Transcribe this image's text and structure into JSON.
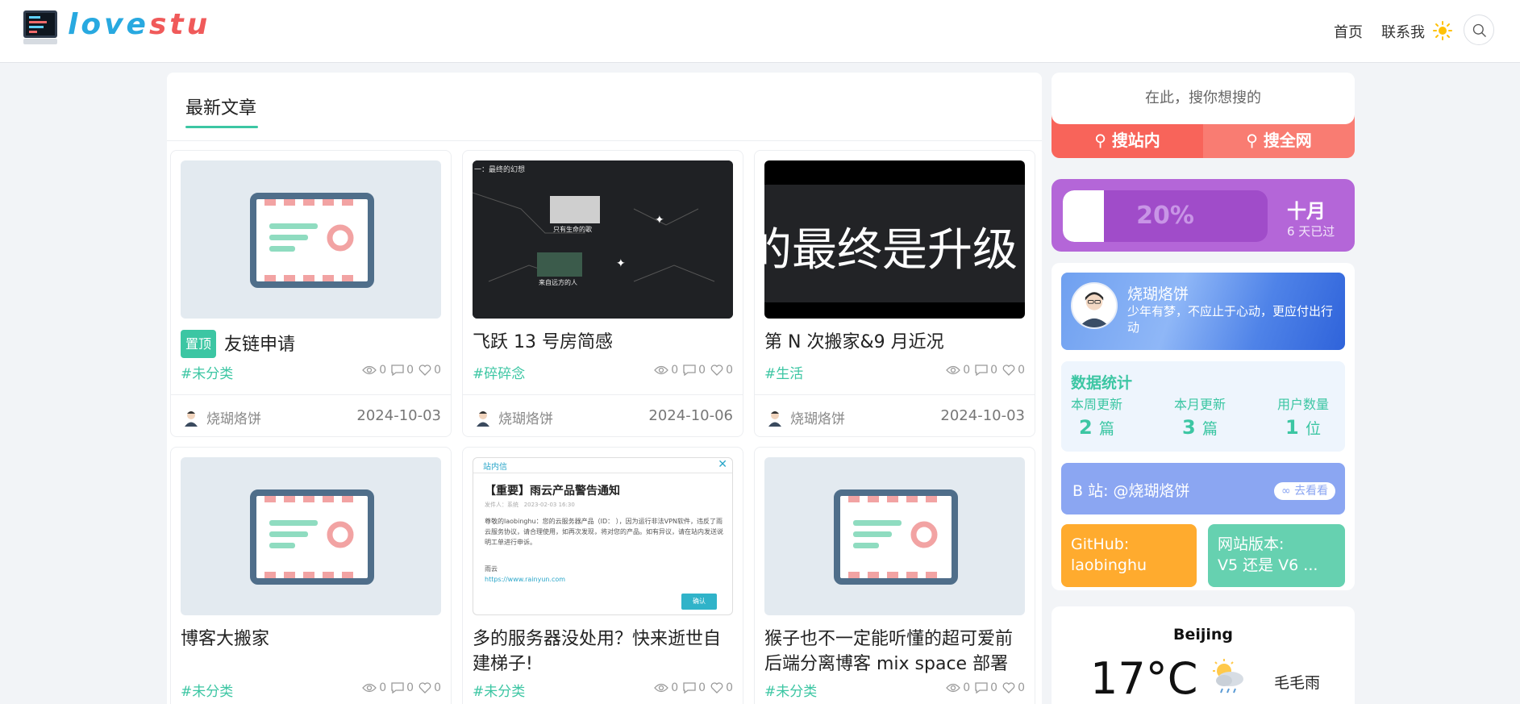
{
  "header": {
    "logo_part1": "love",
    "logo_part2": "stu",
    "nav": [
      "首页",
      "联系我"
    ]
  },
  "main": {
    "section_title": "最新文章",
    "pin_label": "置顶",
    "posts": [
      {
        "title": "友链申请",
        "pinned": true,
        "tag": "#未分类",
        "views": "0",
        "comments": "0",
        "likes": "0",
        "author": "烧瑚烙饼",
        "date": "2024-10-03",
        "thumb": "placeholder"
      },
      {
        "title": "飞跃 13 号房简感",
        "tag": "#碎碎念",
        "views": "0",
        "comments": "0",
        "likes": "0",
        "author": "烧瑚烙饼",
        "date": "2024-10-06",
        "thumb": "dark-video",
        "thumb_text": [
          "一：最终的幻想",
          "只有生命的歌",
          "来自远方的人"
        ]
      },
      {
        "title": "第 N 次搬家&9 月近况",
        "tag": "#生活",
        "views": "0",
        "comments": "0",
        "likes": "0",
        "author": "烧瑚烙饼",
        "date": "2024-10-03",
        "thumb": "dark-text",
        "thumb_text": "的最终是升级"
      },
      {
        "title": "博客大搬家",
        "tag": "#未分类",
        "views": "0",
        "comments": "0",
        "likes": "0",
        "author": "",
        "date": "",
        "thumb": "placeholder"
      },
      {
        "title": "多的服务器没处用？快来逝世自建梯子!",
        "tag": "#未分类",
        "views": "0",
        "comments": "0",
        "likes": "0",
        "author": "",
        "date": "",
        "thumb": "notice",
        "notice": {
          "header": "站内信",
          "title": "【重要】雨云产品警告通知",
          "sender": "发件人：系统",
          "time": "2023-02-03 16:30",
          "body": "尊敬的laobinghu：您的云服务器产品（ID：        ），因为运行非法VPN软件，违反了雨云服务协议，请合理使用，如再次发现，将对您的产品。如有异议，请在站内发送说明工单进行申诉。",
          "sign": "雨云",
          "link": "https://www.rainyun.com",
          "btn": "确认"
        }
      },
      {
        "title": "猴子也不一定能听懂的超可爱前后端分离博客 mix space 部署",
        "tag": "#未分类",
        "views": "0",
        "comments": "0",
        "likes": "0",
        "author": "",
        "date": "",
        "thumb": "placeholder"
      }
    ]
  },
  "sidebar": {
    "search": {
      "placeholder": "在此，搜你想搜的",
      "btn_site": "搜站内",
      "btn_web": "搜全网"
    },
    "progress": {
      "percent_label": "20%",
      "percent": 0.2,
      "month": "十月",
      "sub": "6 天已过"
    },
    "profile": {
      "name": "烧瑚烙饼",
      "bio": "少年有梦，不应止于心动，更应付出行动"
    },
    "stats": {
      "title": "数据统计",
      "items": [
        {
          "label": "本周更新",
          "value": "2",
          "unit": "篇"
        },
        {
          "label": "本月更新",
          "value": "3",
          "unit": "篇"
        },
        {
          "label": "用户数量",
          "value": "1",
          "unit": "位"
        }
      ]
    },
    "bilibili": {
      "text": "B 站: @烧瑚烙饼",
      "btn": "去看看"
    },
    "github": {
      "line1": "GitHub:",
      "line2": "laobinghu"
    },
    "version": {
      "line1": "网站版本:",
      "line2": "V5 还是 V6 ..."
    },
    "weather": {
      "city": "Beijing",
      "temp": "17°C",
      "desc": "毛毛雨"
    }
  }
}
